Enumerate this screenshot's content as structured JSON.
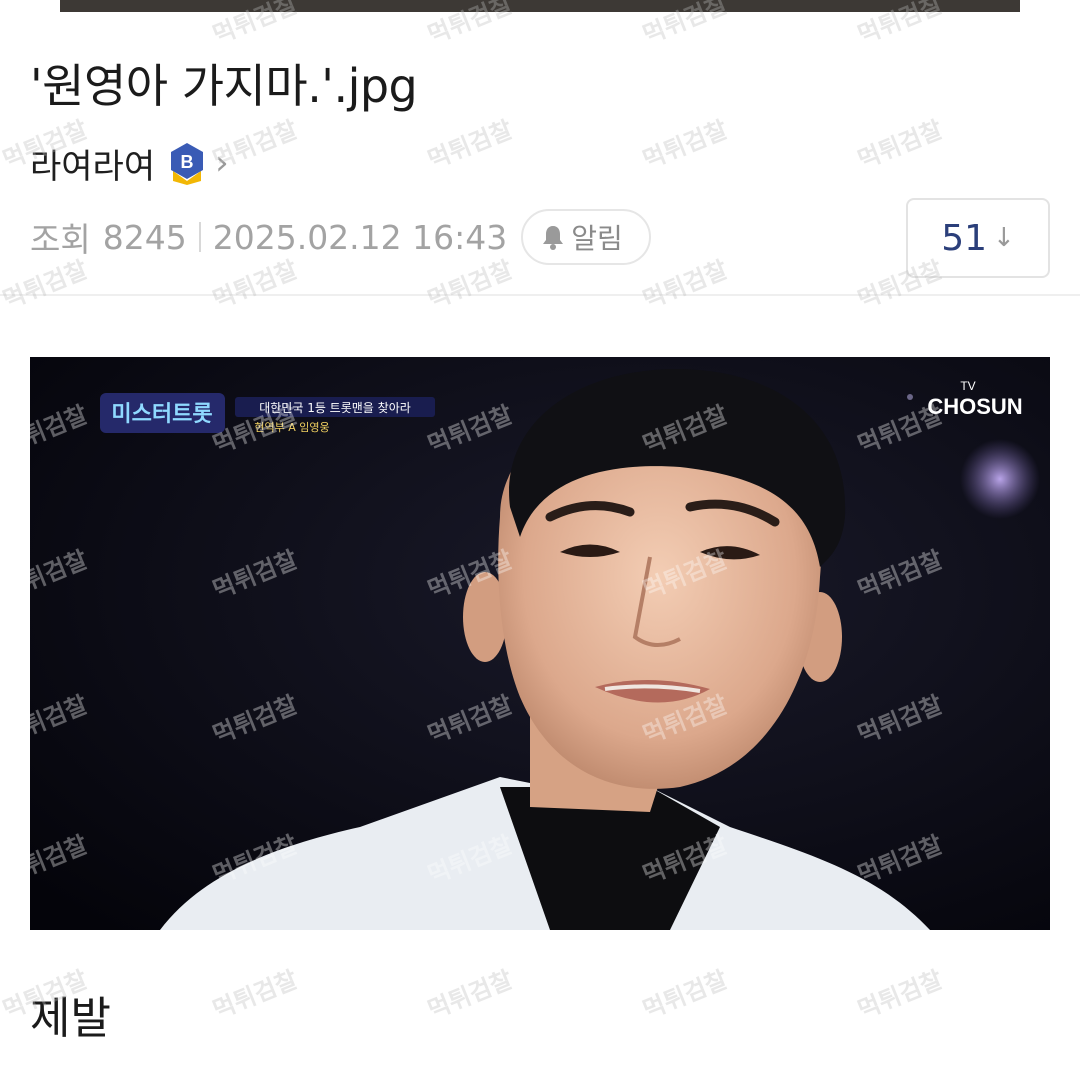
{
  "post": {
    "title": "'원영아 가지마.'.jpg",
    "author": "라여라여",
    "author_badge": "B",
    "author_chevron": "›",
    "views_label": "조회",
    "views": "8245",
    "datetime": "2025.02.12 16:43",
    "alarm_label": "알림",
    "comment_count": "51",
    "comment_arrow": "↓",
    "body": "제발"
  },
  "image": {
    "show_logo": "미스터트롯",
    "caption_top": "대한민국 1등 트롯맨을 찾아라",
    "caption_sub": "현역부 A 임영웅",
    "channel_tv": "TV",
    "channel_name": "CHOSUN"
  },
  "watermark": {
    "text": "먹튀검찰"
  },
  "colors": {
    "badge_blue": "#3a5bb5",
    "badge_gold": "#f2b705",
    "comment_count": "#2b3f7a",
    "meta_gray": "#a3a3a3"
  },
  "icons": {
    "badge": "member-grade-badge-icon",
    "alarm": "bell-icon",
    "chevron": "chevron-right-icon",
    "comment_arrow": "arrow-down-icon"
  }
}
